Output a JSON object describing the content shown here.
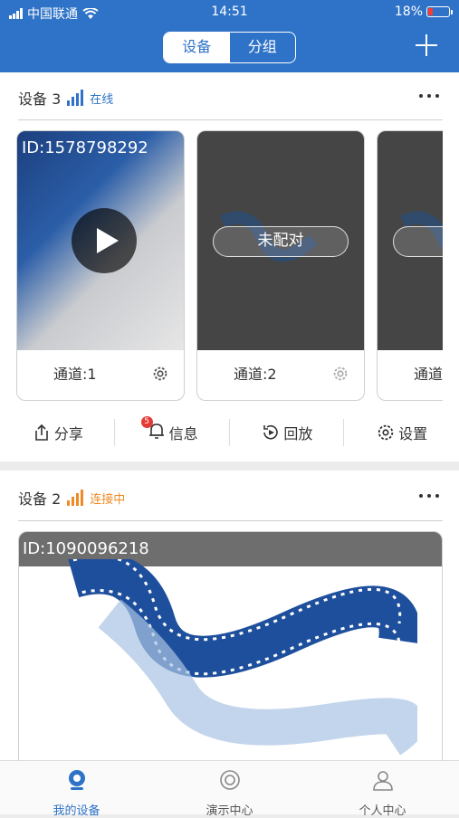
{
  "status": {
    "carrier": "中国联通",
    "time": "14:51",
    "battery": "18%"
  },
  "header": {
    "tabs": [
      "设备",
      "分组"
    ]
  },
  "devices": [
    {
      "name": "设备 3",
      "state": "在线",
      "state_color": "#2f73c8",
      "channels": [
        {
          "id": "ID:1578798292",
          "label": "通道:1",
          "paired": true
        },
        {
          "id": "",
          "label": "通道:2",
          "paired": false,
          "status": "未配对"
        },
        {
          "id": "",
          "label": "通道",
          "paired": false,
          "status": "未"
        }
      ]
    },
    {
      "name": "设备 2",
      "state": "连接中",
      "state_color": "#f08a24",
      "channel_id": "ID:1090096218"
    }
  ],
  "actions": [
    {
      "label": "分享",
      "icon": "share-icon"
    },
    {
      "label": "信息",
      "icon": "bell-icon",
      "badge": "5"
    },
    {
      "label": "回放",
      "icon": "playback-icon"
    },
    {
      "label": "设置",
      "icon": "gear-icon"
    }
  ],
  "tabbar": [
    {
      "label": "我的设备",
      "active": true
    },
    {
      "label": "演示中心"
    },
    {
      "label": "个人中心"
    }
  ]
}
